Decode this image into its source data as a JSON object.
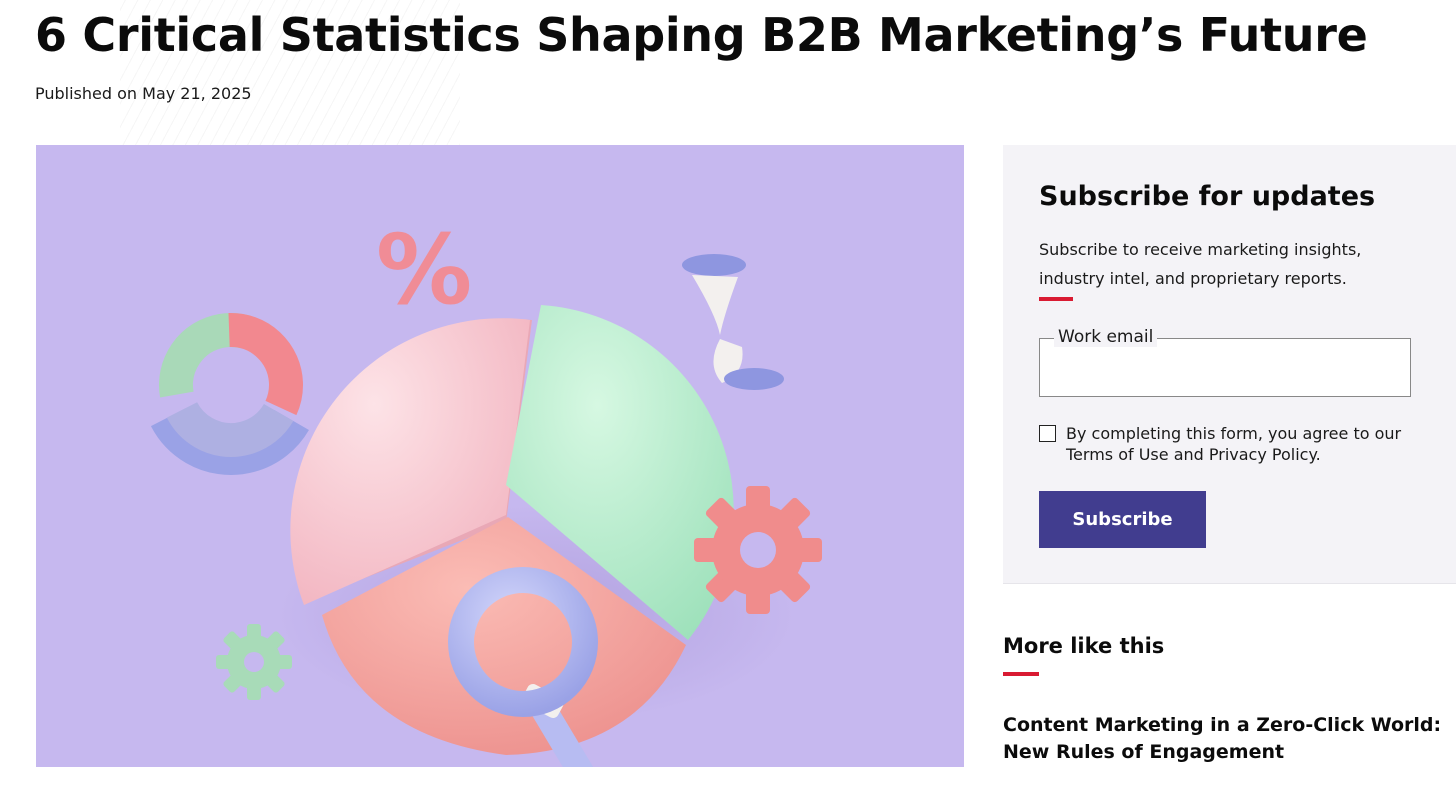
{
  "article": {
    "title": "6 Critical Statistics Shaping B2B Marketing’s Future",
    "published": "Published on May 21, 2025"
  },
  "hero_image": {
    "background": "#c6b8ef",
    "pie_colors": [
      "#f8c7cf",
      "#b9efcd",
      "#f6a3a0"
    ],
    "percent_symbol": "%"
  },
  "subscribe": {
    "title": "Subscribe for updates",
    "description": "Subscribe to receive marketing insights, industry intel, and proprietary reports.",
    "email_label": "Work email",
    "email_value": "",
    "consent_text": "By completing this form, you agree to our Terms of Use and Privacy Policy.",
    "consent_checked": false,
    "button_label": "Subscribe"
  },
  "more_like_this": {
    "title": "More like this",
    "items": [
      {
        "title": "Content Marketing in a Zero-Click World: New Rules of Engagement"
      }
    ]
  },
  "colors": {
    "accent_red": "#d91a32",
    "button_navy": "#413d8f",
    "panel_bg": "#f4f3f7"
  }
}
